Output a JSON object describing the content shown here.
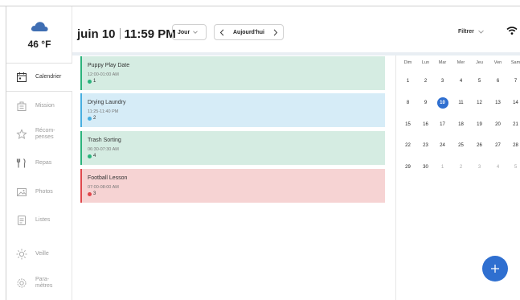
{
  "weather": {
    "icon": "cloud-icon",
    "temperature": "46 °F"
  },
  "sidebar": {
    "items": [
      {
        "label": "Calendrier",
        "icon": "calendar-icon",
        "active": true
      },
      {
        "label": "Mission",
        "icon": "mission-icon",
        "active": false
      },
      {
        "label": "Récom-\npenses",
        "icon": "rewards-icon",
        "active": false
      },
      {
        "label": "Repas",
        "icon": "meals-icon",
        "active": false
      },
      {
        "label": "Photos",
        "icon": "photos-icon",
        "active": false
      },
      {
        "label": "Listes",
        "icon": "lists-icon",
        "active": false
      },
      {
        "label": "Veille",
        "icon": "sun-icon",
        "active": false
      },
      {
        "label": "Para-\nmètres",
        "icon": "settings-icon",
        "active": false
      }
    ]
  },
  "header": {
    "date": "juin 10",
    "time": "11:59 PM",
    "view_label": "Jour",
    "today_label": "Aujourd'hui",
    "filter_label": "Filtrer"
  },
  "events": [
    {
      "title": "Puppy Play Date",
      "time": "12:00-01:00 AM",
      "badge": "1",
      "bg": "#d5ece2",
      "border": "#2bb37c",
      "dot": "#2bb37c"
    },
    {
      "title": "Drying Laundry",
      "time": "11:25-11:40 PM",
      "badge": "2",
      "bg": "#d6ecf7",
      "border": "#46aee0",
      "dot": "#46aee0"
    },
    {
      "title": "Trash Sorting",
      "time": "06:30-07:30 AM",
      "badge": "4",
      "bg": "#d5ece2",
      "border": "#2bb37c",
      "dot": "#2bb37c"
    },
    {
      "title": "Football Lesson",
      "time": "07:00-08:00 AM",
      "badge": "3",
      "bg": "#f6d3d3",
      "border": "#e0474c",
      "dot": "#e0474c"
    }
  ],
  "calendar": {
    "weekdays": [
      "Dim",
      "Lun",
      "Mar",
      "Mer",
      "Jeu",
      "Ven",
      "Sam"
    ],
    "weeks": [
      [
        "1",
        "2",
        "3",
        "4",
        "5",
        "6",
        "7"
      ],
      [
        "8",
        "9",
        "10",
        "11",
        "12",
        "13",
        "14"
      ],
      [
        "15",
        "16",
        "17",
        "18",
        "19",
        "20",
        "21"
      ],
      [
        "22",
        "23",
        "24",
        "25",
        "26",
        "27",
        "28"
      ],
      [
        "29",
        "30",
        "1",
        "2",
        "3",
        "4",
        "5"
      ]
    ],
    "selected": "10",
    "accent": "#2f6fd0"
  }
}
